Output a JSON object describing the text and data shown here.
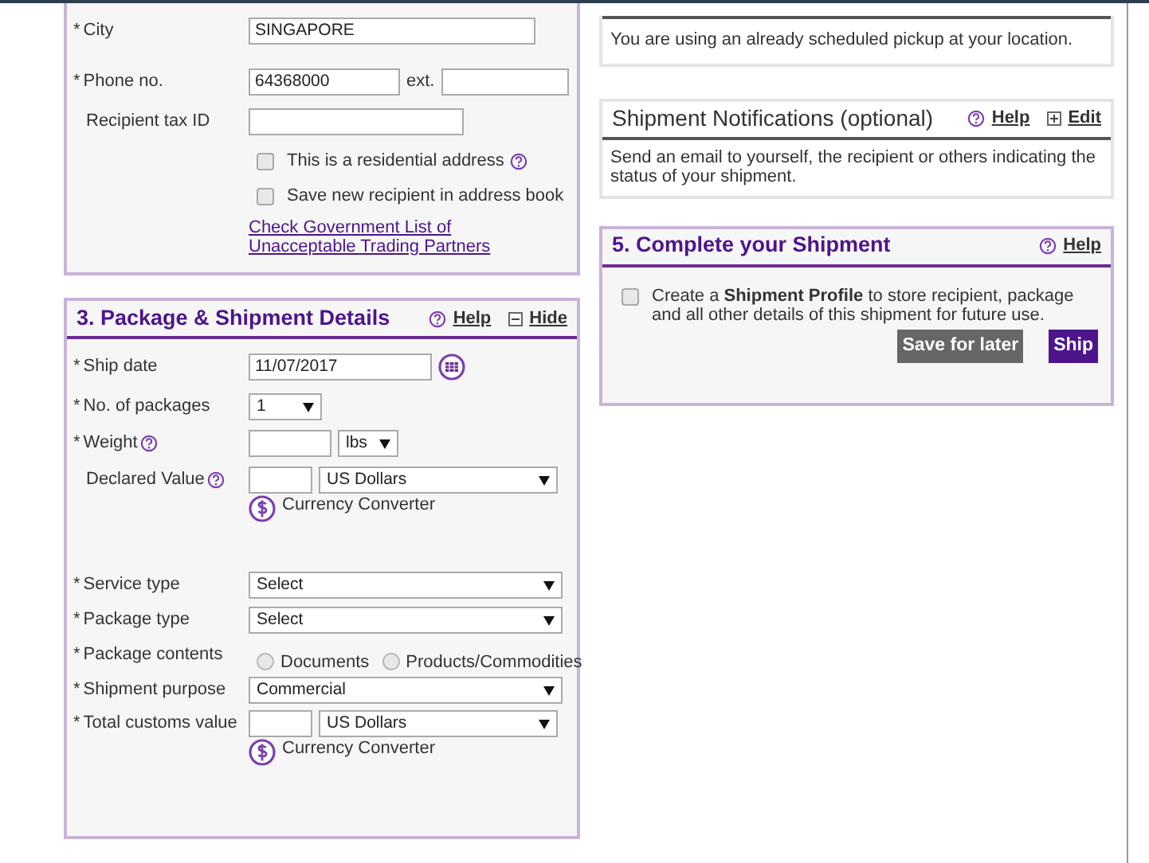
{
  "recipient_section": {
    "fields": [
      {
        "kind": "text",
        "required_mark": "*",
        "label": "City",
        "value": "SINGAPORE"
      },
      {
        "kind": "phone",
        "required_mark": "*",
        "label": "Phone no.",
        "value": "64368000",
        "ext_label": "ext."
      },
      {
        "kind": "text",
        "label": "Recipient tax ID"
      },
      {
        "kind": "checkbox",
        "label": "This is a residential address",
        "checked": false,
        "help": true
      },
      {
        "kind": "checkbox",
        "label": "Save new recipient in address book",
        "checked": false,
        "help": false
      },
      {
        "kind": "link",
        "label": "Check Government List of Unacceptable Trading Partners"
      }
    ]
  },
  "package_section": {
    "title": "3. Package & Shipment Details",
    "help_label": "Help",
    "toggle_label": "Hide",
    "fields": [
      {
        "kind": "date",
        "required_mark": "*",
        "label": "Ship date",
        "value": "11/07/2017"
      },
      {
        "kind": "small_select",
        "required_mark": "*",
        "label": "No. of packages",
        "value": "1"
      },
      {
        "kind": "weight",
        "required_mark": "*",
        "label": "Weight",
        "help": true,
        "unit": "lbs"
      },
      {
        "kind": "money",
        "label": "Declared Value",
        "help": true,
        "currency": "US Dollars",
        "converter": "Currency Converter"
      },
      {
        "kind": "spacer"
      },
      {
        "kind": "select",
        "required_mark": "*",
        "label": "Service type",
        "value": "Select"
      },
      {
        "kind": "select",
        "required_mark": "*",
        "label": "Package type",
        "value": "Select"
      },
      {
        "kind": "radio",
        "required_mark": "*",
        "label": "Package contents",
        "options": [
          {
            "label": "Documents",
            "selected": false
          },
          {
            "label": "Products/Commodities",
            "selected": false
          }
        ]
      },
      {
        "kind": "select",
        "required_mark": "*",
        "label": "Shipment purpose",
        "value": "Commercial"
      },
      {
        "kind": "money",
        "required_mark": "*",
        "label": "Total customs value",
        "help": false,
        "currency": "US Dollars",
        "converter": "Currency Converter"
      }
    ]
  },
  "pickup_panel": {
    "text": "You are using an already scheduled pickup at your location."
  },
  "notifications_panel": {
    "title": "Shipment Notifications (optional)",
    "help_label": "Help",
    "toggle_label": "Edit",
    "text": "Send an email to yourself, the recipient or others indicating the status of your shipment."
  },
  "complete_panel": {
    "title": "5. Complete your Shipment",
    "help_label": "Help",
    "profile_checkbox": {
      "label": "Create a **Shipment Profile** to store recipient, package and all other details of this shipment for future use.",
      "checked": false
    },
    "buttons": [
      {
        "label": "Save for later",
        "kind": "secondary"
      },
      {
        "label": "Ship",
        "kind": "primary"
      }
    ]
  }
}
